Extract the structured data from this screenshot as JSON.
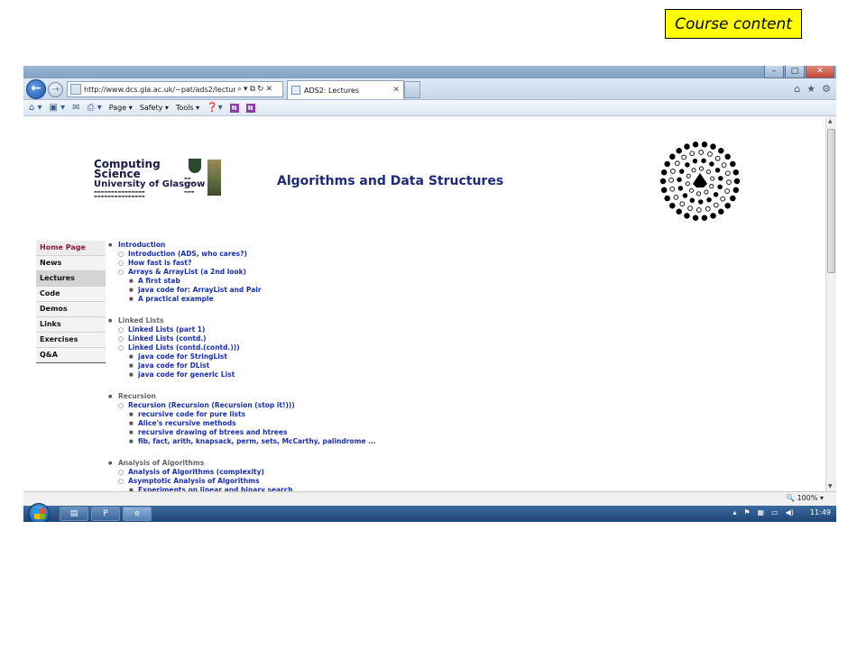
{
  "slide": {
    "label": "Course content"
  },
  "browser": {
    "address": "http://www.dcs.gla.ac.uk/~pat/ads2/lectures.ht",
    "tab_label": "ADS2: Lectures",
    "commands": [
      "Page ▾",
      "Safety ▾",
      "Tools ▾"
    ],
    "zoom": "100%"
  },
  "page": {
    "logo": {
      "line1": "Computing",
      "line2": "Science",
      "line3": "University of Glasgow"
    },
    "heading": "Algorithms and Data Structures",
    "nav": [
      "Home Page",
      "News",
      "Lectures",
      "Code",
      "Demos",
      "Links",
      "Exercises",
      "Q&A"
    ],
    "sections": [
      {
        "title": "Introduction",
        "items": [
          {
            "label": "Introduction (ADS, who cares?)",
            "sub": []
          },
          {
            "label": "How fast is fast?",
            "sub": []
          },
          {
            "label": "Arrays & ArrayList (a 2nd look)",
            "sub": [
              "A first stab",
              "java code for: ArrayList and Pair",
              "A practical example"
            ]
          }
        ]
      },
      {
        "title": "Linked Lists",
        "items": [
          {
            "label": "Linked Lists (part 1)",
            "sub": []
          },
          {
            "label": "Linked Lists (contd.)",
            "sub": []
          },
          {
            "label": "Linked Lists (contd.(contd.)))",
            "sub": [
              "java code for StringList",
              "java code for DList",
              "java code for generic List"
            ]
          }
        ]
      },
      {
        "title": "Recursion",
        "items": [
          {
            "label": "Recursion (Recursion (Recursion (stop it!)))",
            "sub": [
              "recursive code for pure lists",
              "Alice's recursive methods",
              "recursive drawing of btrees and htrees",
              "fib, fact, arith, knapsack, perm, sets, McCarthy, palindrome ..."
            ]
          }
        ]
      },
      {
        "title": "Analysis of Algorithms",
        "items": [
          {
            "label": "Analysis of Algorithms (complexity)",
            "sub": []
          },
          {
            "label": "Asymptotic Analysis of Algorithms",
            "sub": [
              "Experiments on linear and binary search"
            ]
          }
        ]
      }
    ]
  },
  "taskbar": {
    "time": "11:49"
  }
}
